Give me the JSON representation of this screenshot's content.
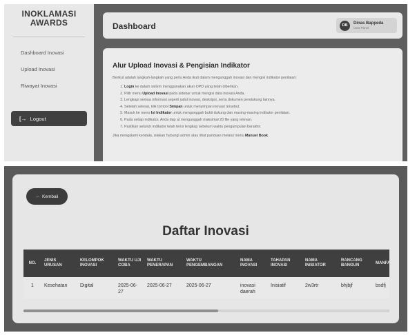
{
  "sidebar": {
    "logo_line1": "INOKLAMASI",
    "logo_line2": "AWARDS",
    "items": [
      {
        "label": "Dashboard Inovasi"
      },
      {
        "label": "Upload Inovasi"
      },
      {
        "label": "Riwayat Inovasi"
      }
    ],
    "logout_label": "Logout",
    "logout_icon": "[→"
  },
  "header": {
    "title": "Dashboard",
    "user": {
      "initials": "DB",
      "name": "Dinas Bappeda",
      "role": "User Panel"
    }
  },
  "content": {
    "title": "Alur Upload Inovasi & Pengisian Indikator",
    "intro": "Berikut adalah langkah-langkah yang perlu Anda ikuti dalam mengunggah inovasi dan mengisi indikator penilaian:",
    "steps": [
      {
        "bold": "Login",
        "rest": " ke dalam sistem menggunakan akun OPD yang telah diberikan."
      },
      {
        "pre": "Pilih menu ",
        "bold": "Upload Inovasi",
        "rest": " pada sidebar untuk mengisi data inovasi Anda."
      },
      {
        "pre": "",
        "bold": "",
        "rest": "Lengkapi semua informasi seperti judul inovasi, deskripsi, serta dokumen pendukung lainnya."
      },
      {
        "pre": "Setelah selesai, klik tombol ",
        "bold": "Simpan",
        "rest": " untuk menyimpan inovasi tersebut."
      },
      {
        "pre": "Masuk ke menu ",
        "bold": "Isi Indikator",
        "rest": " untuk mengunggah bukti dukung dan masing-masing indikator penilaian."
      },
      {
        "pre": "",
        "bold": "",
        "rest": "Pada setiap indikator, Anda dap at mengunggah maksimal 20 file yang relevan."
      },
      {
        "pre": "",
        "bold": "",
        "rest": "Pastikan seluruh indikator telah terisi lengkap sebelum waktu pengumpulan berakhir."
      }
    ],
    "footer_pre": "Jika mengalami kendala, silakan hubungi admin atau lihat panduan melalui menu ",
    "footer_bold": "Manuel Book",
    "footer_post": "."
  },
  "list": {
    "back_label": "Kembali",
    "back_icon": "←",
    "title": "Daftar Inovasi",
    "columns": [
      "NO.",
      "JENIS URUSAN",
      "KELOMPOK INOVASI",
      "WAKTU UJI COBA",
      "WAKTU PENERAPAN",
      "WAKTU PENGEMBANGAN",
      "NAMA INOVASI",
      "TAHAPAN INOVASI",
      "NAMA INISIATOR",
      "RANCANG BANGUN",
      "MANFAAT INOVASI"
    ],
    "rows": [
      [
        "1",
        "Kesehatan",
        "Digital",
        "2025-06-27",
        "2025-06-27",
        "2025-06-27",
        "inovasi daerah",
        "Inisiatif",
        "2w3rtr",
        "bhjbjf",
        "bsdfj"
      ]
    ]
  }
}
